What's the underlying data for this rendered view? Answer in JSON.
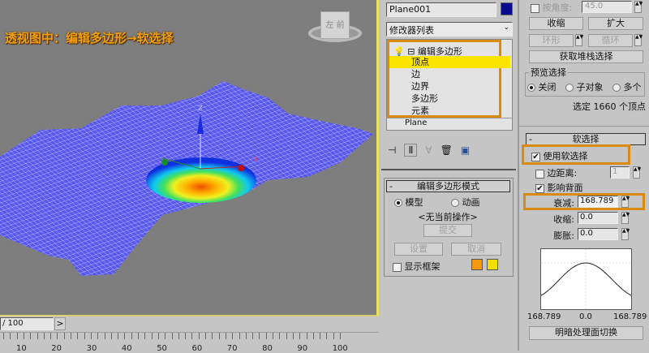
{
  "viewport": {
    "title": "透视图中：编辑多边形→软选择",
    "gizmo_axes": {
      "z": "Z",
      "x": "X"
    },
    "viewcube_label": "左 前"
  },
  "timeline": {
    "frame": "/ 100",
    "next": ">",
    "ticks": [
      "10",
      "20",
      "30",
      "40",
      "50",
      "60",
      "70",
      "80",
      "90",
      "100"
    ]
  },
  "modify": {
    "object_name": "Plane001",
    "object_color": "#0a0a8c",
    "modifier_list": "修改器列表",
    "stack": {
      "modifier": "编辑多边形",
      "items": [
        "顶点",
        "边",
        "边界",
        "多边形",
        "元素"
      ],
      "selected": "顶点",
      "base": "Plane"
    },
    "icons": [
      "pin-stack-icon",
      "show-end-result-icon",
      "make-unique-icon",
      "remove-modifier-icon",
      "configure-sets-icon"
    ]
  },
  "edit_poly_mode": {
    "title": "编辑多边形模式",
    "model": "模型",
    "animate": "动画",
    "status": "<无当前操作>",
    "commit": "提交",
    "settings": "设置",
    "cancel": "取消",
    "show_cage": "显示框架",
    "cage_colors": [
      "#f59a10",
      "#f2e000"
    ]
  },
  "selection": {
    "by_angle": "按角度:",
    "angle_value": "45.0",
    "shrink": "收缩",
    "grow": "扩大",
    "ring": "环形",
    "loop": "循环",
    "get_stack": "获取堆栈选择",
    "preview_title": "预览选择",
    "preview_off": "关闭",
    "preview_sub": "子对象",
    "preview_multi": "多个",
    "status": "选定 1660 个顶点"
  },
  "soft_selection": {
    "title": "软选择",
    "use_soft": "使用软选择",
    "edge_distance": "边距离:",
    "edge_distance_value": "1",
    "affect_backfacing": "影响背面",
    "falloff": "衰减:",
    "falloff_value": "168.789",
    "pinch": "收缩:",
    "pinch_value": "0.0",
    "bubble": "膨胀:",
    "bubble_value": "0.0",
    "curve_left": "168.789",
    "curve_mid": "0.0",
    "curve_right": "168.789",
    "shaded_face_toggle": "明暗处理面切换"
  }
}
